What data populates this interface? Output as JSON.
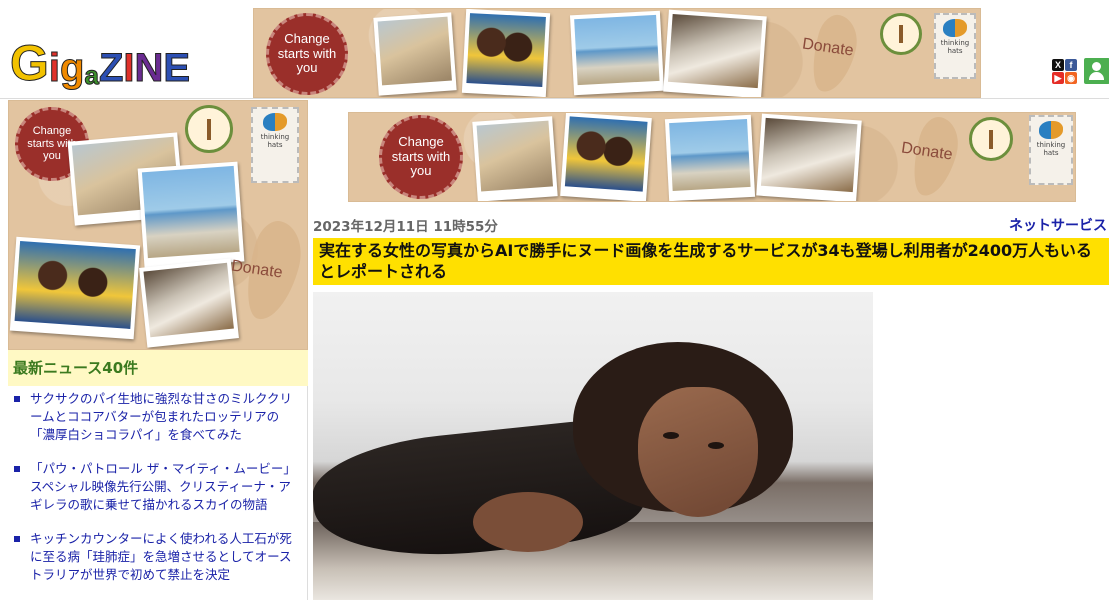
{
  "header": {
    "logo_text": "GIGAZINE",
    "banner_top": {
      "stamp_text": "Change starts with you",
      "donate_label": "Donate",
      "sponsor_label": "thinking hats"
    },
    "social_icons": [
      "x-icon",
      "facebook-icon",
      "youtube-icon",
      "rss-icon"
    ],
    "user_icon": "user-icon"
  },
  "sidebar": {
    "banner": {
      "stamp_text": "Change starts with you",
      "donate_label": "Donate",
      "sponsor_label": "thinking hats"
    },
    "heading": "最新ニュース40件",
    "items": [
      "サクサクのパイ生地に強烈な甘さのミルククリームとココアバターが包まれたロッテリアの「濃厚白ショコラパイ」を食べてみた",
      "「パウ・パトロール ザ・マイティ・ムービー」スペシャル映像先行公開、クリスティーナ・アギレラの歌に乗せて描かれるスカイの物語",
      "キッチンカウンターによく使われる人工石が死に至る病「珪肺症」を急増させるとしてオーストラリアが世界で初めて禁止を決定"
    ]
  },
  "article": {
    "banner": {
      "stamp_text": "Change starts with you",
      "donate_label": "Donate",
      "sponsor_label": "thinking hats"
    },
    "date": "2023年12月11日 11時55分",
    "category": "ネットサービス",
    "headline": "実在する女性の写真からAIで勝手にヌード画像を生成するサービスが34も登場し利用者が2400万人もいるとレポートされる"
  },
  "colors": {
    "accent_yellow": "#ffe000",
    "sidebar_heading_bg": "#fff9c4",
    "link_blue": "#1a22a8",
    "sidebar_heading_text": "#3b7a1f"
  }
}
